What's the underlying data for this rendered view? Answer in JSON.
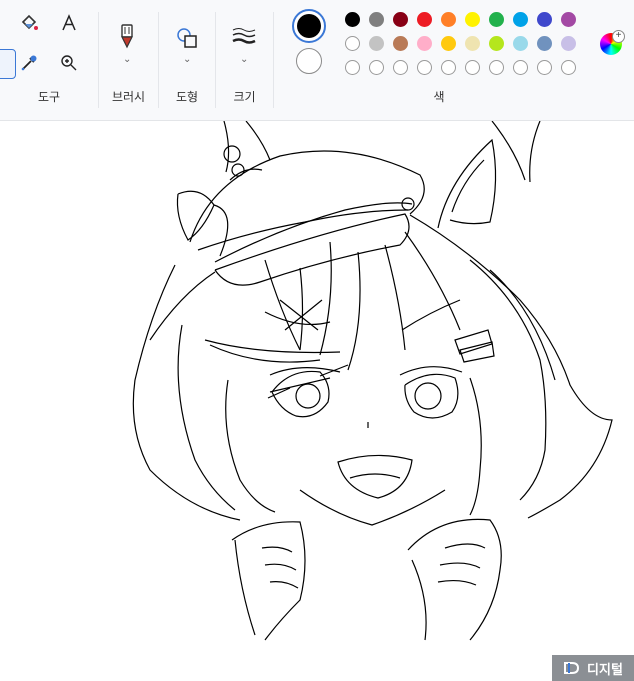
{
  "ribbon": {
    "tools_label": "도구",
    "brushes_label": "브러시",
    "shapes_label": "도형",
    "size_label": "크기",
    "colors_label": "색"
  },
  "colors": {
    "primary": "#000000",
    "secondary": "#ffffff",
    "row1": [
      "#000000",
      "#7f7f7f",
      "#880015",
      "#ed1c24",
      "#ff7f27",
      "#fff200",
      "#22b14c",
      "#00a2e8",
      "#3f48cc",
      "#a349a4"
    ],
    "row2": [
      "#ffffff",
      "#c3c3c3",
      "#b97a57",
      "#ffaec9",
      "#ffc90e",
      "#efe4b0",
      "#b5e61d",
      "#99d9ea",
      "#7092be",
      "#c8bfe7"
    ],
    "row3_count": 10
  },
  "watermark": {
    "text": "디지털"
  }
}
